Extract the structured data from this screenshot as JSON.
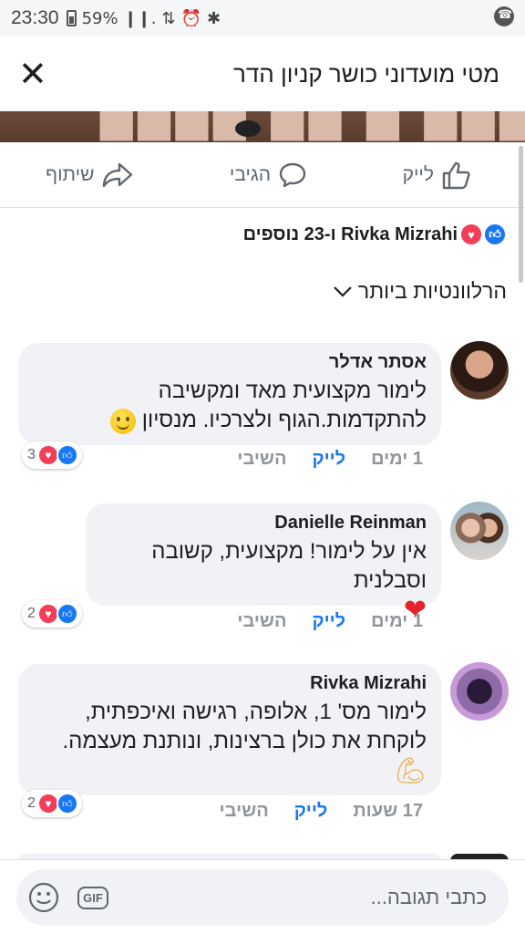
{
  "status_bar": {
    "time": "23:30",
    "battery": "59%",
    "signal_text": "❙❙ ☰"
  },
  "header": {
    "title": "מטי מועדוני כושר קניון הדר",
    "close_glyph": "✕"
  },
  "actions": {
    "like_label": "לייק",
    "comment_label": "הגיבי",
    "share_label": "שיתוף"
  },
  "reactions_summary": {
    "text": "Rivka Mizrahi ו-23 נוספים"
  },
  "sort": {
    "label": "הרלוונטיות ביותר"
  },
  "comments": [
    {
      "author": "אסתר אדלר",
      "text_line1": "לימור מקצועית מאד ומקשיבה",
      "text_line2": "להתקדמות.הגוף ולצרכיו. מנסיון",
      "time": "1 ימים",
      "like": "לייק",
      "reply": "השיבי",
      "reaction_count": "3"
    },
    {
      "author": "Danielle Reinman",
      "text_line1": "אין על לימור! מקצועית, קשובה וסבלנית",
      "text_line2": "",
      "time": "1 ימים",
      "like": "לייק",
      "reply": "השיבי",
      "reaction_count": "2"
    },
    {
      "author": "Rivka Mizrahi",
      "text_line1": "לימור מס' 1, אלופה, רגישה ואיכפתית,",
      "text_line2": "לוקחת את כולן ברצינות, ונותנת מעצמה.",
      "time": "17 שעות",
      "like": "לייק",
      "reply": "השיבי",
      "reaction_count": "2"
    }
  ],
  "reply_bar": {
    "placeholder": "כתבי תגובה...",
    "gif_label": "GIF"
  },
  "colors": {
    "like_blue": "#1877f2",
    "love_red": "#f33e58",
    "bubble_bg": "#f0f2f5",
    "meta_gray": "#90949c"
  }
}
